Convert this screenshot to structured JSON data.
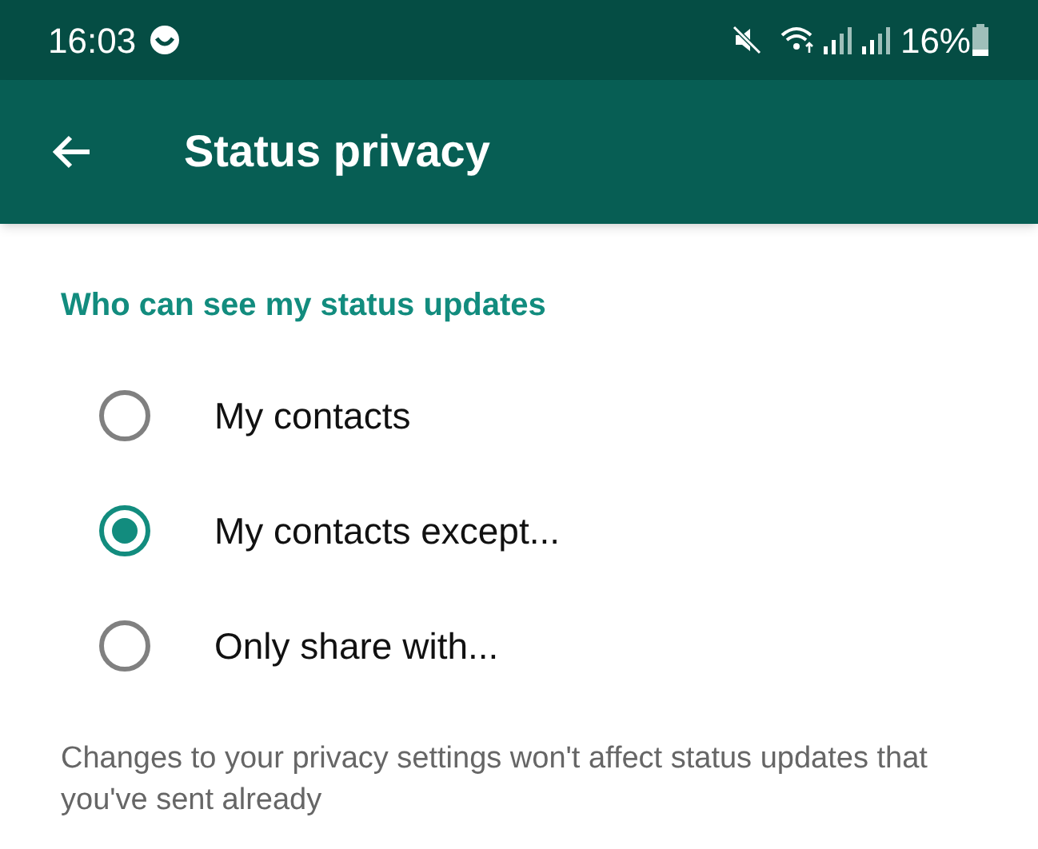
{
  "status_bar": {
    "time": "16:03",
    "battery_percent": "16%"
  },
  "app_bar": {
    "title": "Status privacy"
  },
  "section": {
    "heading": "Who can see my status updates",
    "options": [
      {
        "label": "My contacts",
        "selected": false
      },
      {
        "label": "My contacts except...",
        "selected": true
      },
      {
        "label": "Only share with...",
        "selected": false
      }
    ]
  },
  "footer_note": "Changes to your privacy settings won't affect status updates that you've sent already"
}
